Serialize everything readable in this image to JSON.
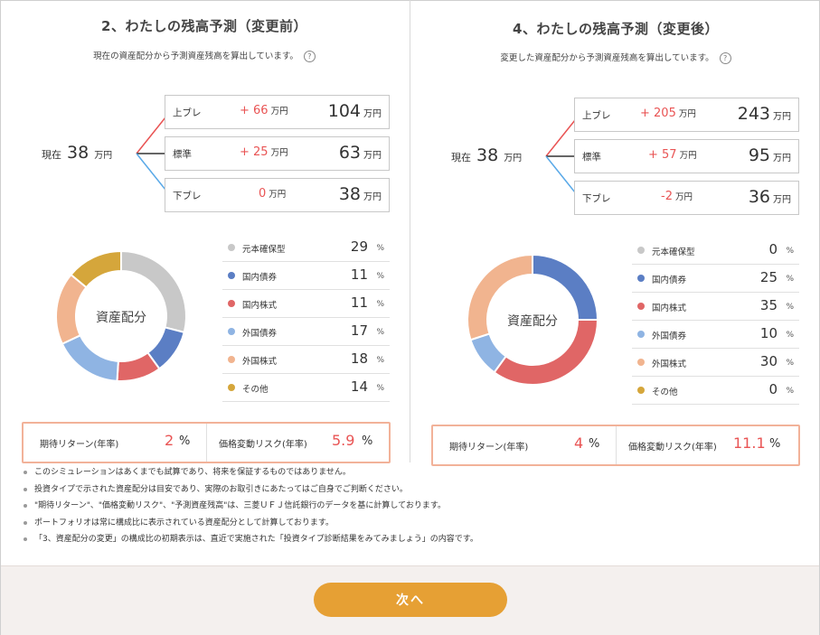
{
  "colors": {
    "accent_red": "#e95454",
    "button": "#e6a034",
    "metric_border": "#f2b299",
    "branch_up": "#e95454",
    "branch_std": "#333333",
    "branch_down": "#5aa9e8"
  },
  "before": {
    "title": "2、わたしの残高予測（変更前）",
    "subtitle": "現在の資産配分から予測資産残高を算出しています。",
    "help_icon": "?",
    "current_label": "現在",
    "current_value": "38",
    "current_unit": "万円",
    "forecasts": [
      {
        "label": "上ブレ",
        "delta": "+ 66",
        "delta_unit": "万円",
        "value": "104",
        "unit": "万円"
      },
      {
        "label": "標準",
        "delta": "+ 25",
        "delta_unit": "万円",
        "value": "63",
        "unit": "万円"
      },
      {
        "label": "下ブレ",
        "delta": "0",
        "delta_unit": "万円",
        "value": "38",
        "unit": "万円"
      }
    ],
    "donut_label": "資産配分",
    "allocation": [
      {
        "label": "元本確保型",
        "value": "29",
        "pct": "%",
        "color": "#c8c8c8",
        "icon": "circle-icon"
      },
      {
        "label": "国内債券",
        "value": "11",
        "pct": "%",
        "color": "#5b7ec4",
        "icon": "circle-icon"
      },
      {
        "label": "国内株式",
        "value": "11",
        "pct": "%",
        "color": "#e06666",
        "icon": "circle-icon"
      },
      {
        "label": "外国債券",
        "value": "17",
        "pct": "%",
        "color": "#8fb4e3",
        "icon": "circle-icon"
      },
      {
        "label": "外国株式",
        "value": "18",
        "pct": "%",
        "color": "#f1b48f",
        "icon": "circle-icon"
      },
      {
        "label": "その他",
        "value": "14",
        "pct": "%",
        "color": "#d5a63b",
        "icon": "circle-icon"
      }
    ],
    "expected_return_label": "期待リターン(年率)",
    "expected_return_value": "2",
    "expected_return_unit": "%",
    "risk_label": "価格変動リスク(年率)",
    "risk_value": "5.9",
    "risk_unit": "%"
  },
  "after": {
    "title": "4、わたしの残高予測（変更後）",
    "subtitle": "変更した資産配分から予測資産残高を算出しています。",
    "help_icon": "?",
    "current_label": "現在",
    "current_value": "38",
    "current_unit": "万円",
    "forecasts": [
      {
        "label": "上ブレ",
        "delta": "+ 205",
        "delta_unit": "万円",
        "value": "243",
        "unit": "万円"
      },
      {
        "label": "標準",
        "delta": "+ 57",
        "delta_unit": "万円",
        "value": "95",
        "unit": "万円"
      },
      {
        "label": "下ブレ",
        "delta": "-2",
        "delta_unit": "万円",
        "value": "36",
        "unit": "万円"
      }
    ],
    "donut_label": "資産配分",
    "allocation": [
      {
        "label": "元本確保型",
        "value": "0",
        "pct": "%",
        "color": "#c8c8c8",
        "icon": "circle-icon"
      },
      {
        "label": "国内債券",
        "value": "25",
        "pct": "%",
        "color": "#5b7ec4",
        "icon": "circle-icon"
      },
      {
        "label": "国内株式",
        "value": "35",
        "pct": "%",
        "color": "#e06666",
        "icon": "circle-icon"
      },
      {
        "label": "外国債券",
        "value": "10",
        "pct": "%",
        "color": "#8fb4e3",
        "icon": "circle-icon"
      },
      {
        "label": "外国株式",
        "value": "30",
        "pct": "%",
        "color": "#f1b48f",
        "icon": "circle-icon"
      },
      {
        "label": "その他",
        "value": "0",
        "pct": "%",
        "color": "#d5a63b",
        "icon": "circle-icon"
      }
    ],
    "expected_return_label": "期待リターン(年率)",
    "expected_return_value": "4",
    "expected_return_unit": "%",
    "risk_label": "価格変動リスク(年率)",
    "risk_value": "11.1",
    "risk_unit": "%"
  },
  "notes": [
    "このシミュレーションはあくまでも試算であり、将来を保証するものではありません。",
    "投資タイプで示された資産配分は目安であり、実際のお取引きにあたってはご自身でご判断ください。",
    "\"期待リターン\"、\"価格変動リスク\"、\"予測資産残高\"は、三菱ＵＦＪ信託銀行のデータを基に計算しております。",
    "ポートフォリオは常に構成比に表示されている資産配分として計算しております。",
    "「3、資産配分の変更」の構成比の初期表示は、直近で実施された「投資タイプ診断結果をみてみましょう」の内容です。"
  ],
  "next_button": "次へ"
}
